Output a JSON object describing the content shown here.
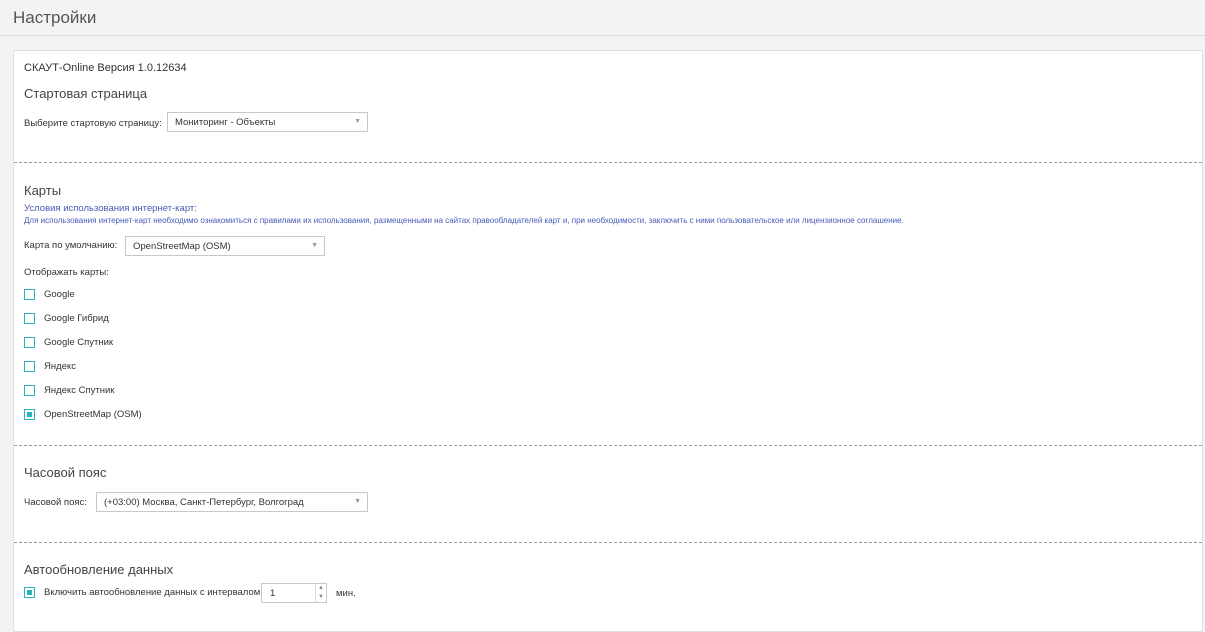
{
  "header": {
    "title": "Настройки"
  },
  "app": {
    "version": "СКАУТ-Online Версия 1.0.12634"
  },
  "start_page": {
    "title": "Стартовая страница",
    "label": "Выберите стартовую страницу:",
    "value": "Мониторинг - Объекты"
  },
  "maps": {
    "title": "Карты",
    "terms_title": "Условия использования интернет-карт:",
    "terms_text": "Для использования интернет-карт необходимо ознакомиться с правилами их использования, размещенными на сайтах правообладателей карт и, при необходимости, заключить с ними пользовательское или лицензионное соглашение.",
    "default_label": "Карта по умолчанию:",
    "default_value": "OpenStreetMap (OSM)",
    "display_label": "Отображать карты:",
    "options": [
      {
        "label": "Google",
        "checked": false
      },
      {
        "label": "Google Гибрид",
        "checked": false
      },
      {
        "label": "Google Спутник",
        "checked": false
      },
      {
        "label": "Яндекс",
        "checked": false
      },
      {
        "label": "Яндекс Спутник",
        "checked": false
      },
      {
        "label": "OpenStreetMap (OSM)",
        "checked": true
      }
    ]
  },
  "timezone": {
    "title": "Часовой пояс",
    "label": "Часовой пояс:",
    "value": "(+03:00) Москва, Санкт-Петербург, Волгоград"
  },
  "autorefresh": {
    "title": "Автообновление данных",
    "checkbox_label": "Включить автообновление данных с интервалом",
    "checked": true,
    "interval": "1",
    "unit": "мин."
  },
  "colors": {
    "accent": "#2bb3c0",
    "link": "#4a5ab8"
  },
  "icons": {
    "dropdown": "triangle-down",
    "spin_up": "triangle-up",
    "spin_down": "triangle-down"
  }
}
